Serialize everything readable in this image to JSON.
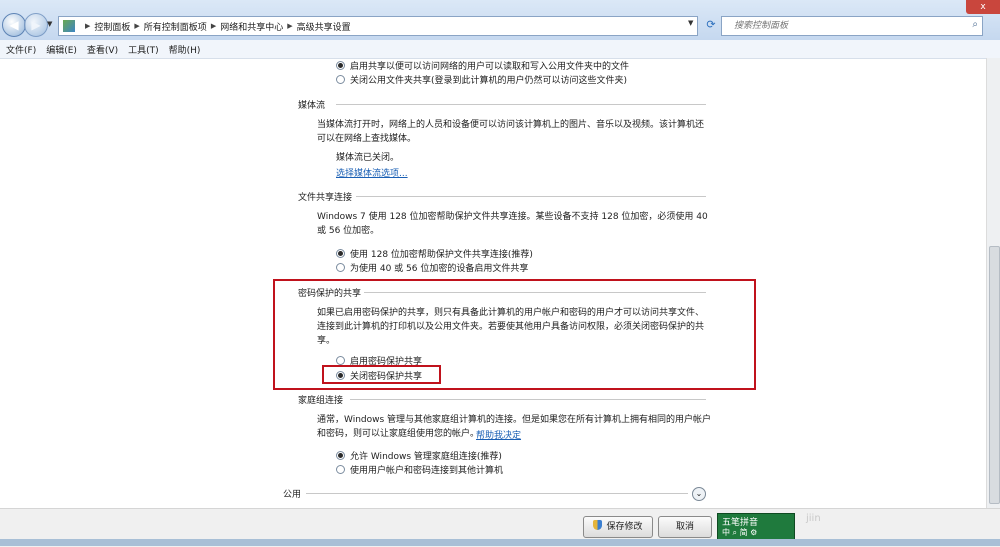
{
  "window": {
    "close_label": "x"
  },
  "address": {
    "crumbs": [
      "控制面板",
      "所有控制面板项",
      "网络和共享中心",
      "高级共享设置"
    ],
    "search_placeholder": "搜索控制面板"
  },
  "menu": [
    "文件(F)",
    "编辑(E)",
    "查看(V)",
    "工具(T)",
    "帮助(H)"
  ],
  "top_options": [
    {
      "label": "启用共享以便可以访问网络的用户可以读取和写入公用文件夹中的文件",
      "selected": true
    },
    {
      "label": "关闭公用文件夹共享(登录到此计算机的用户仍然可以访问这些文件夹)",
      "selected": false
    }
  ],
  "media": {
    "title": "媒体流",
    "desc1": "当媒体流打开时，网络上的人员和设备便可以访问该计算机上的图片、音乐以及视频。该计算机还",
    "desc2": "可以在网络上查找媒体。",
    "status": "媒体流已关闭。",
    "link": "选择媒体流选项..."
  },
  "file_sharing": {
    "title": "文件共享连接",
    "desc1": "Windows 7 使用 128 位加密帮助保护文件共享连接。某些设备不支持 128 位加密，必须使用 40",
    "desc2": "或 56 位加密。",
    "options": [
      {
        "label": "使用 128 位加密帮助保护文件共享连接(推荐)",
        "selected": true
      },
      {
        "label": "为使用 40 或 56 位加密的设备启用文件共享",
        "selected": false
      }
    ]
  },
  "password": {
    "title": "密码保护的共享",
    "desc1": "如果已启用密码保护的共享，则只有具备此计算机的用户帐户和密码的用户才可以访问共享文件、",
    "desc2": "连接到此计算机的打印机以及公用文件夹。若要使其他用户具备访问权限，必须关闭密码保护的共",
    "desc3": "享。",
    "options": [
      {
        "label": "启用密码保护共享",
        "selected": false
      },
      {
        "label": "关闭密码保护共享",
        "selected": true
      }
    ]
  },
  "homegroup": {
    "title": "家庭组连接",
    "desc1": "通常，Windows 管理与其他家庭组计算机的连接。但是如果您在所有计算机上拥有相同的用户帐户",
    "desc2": "和密码，则可以让家庭组使用您的帐户。",
    "link": "帮助我决定",
    "options": [
      {
        "label": "允许 Windows 管理家庭组连接(推荐)",
        "selected": true
      },
      {
        "label": "使用用户帐户和密码连接到其他计算机",
        "selected": false
      }
    ]
  },
  "public_section": {
    "title": "公用"
  },
  "buttons": {
    "save": "保存修改",
    "cancel": "取消"
  },
  "ime": {
    "line1": "五笔拼音",
    "line2": "中 ⌕ 简 ⚙"
  },
  "watermark": "jiin"
}
